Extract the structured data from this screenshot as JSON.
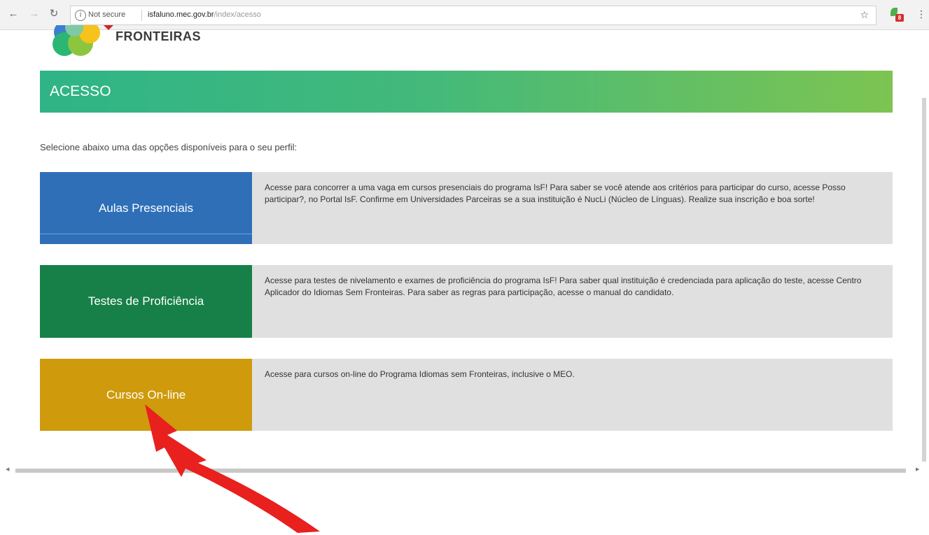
{
  "browser": {
    "security_info_glyph": "i",
    "security_label": "Not secure",
    "url_host": "isfaluno.mec.gov.br",
    "url_path": "/index/acesso",
    "icons": [
      "back-icon",
      "forward-icon",
      "reload-icon",
      "info-icon",
      "star-icon",
      "extension-icon",
      "menu-icon"
    ],
    "extension_badge": "8"
  },
  "brand": {
    "name": "FRONTEIRAS",
    "logo_colors": [
      "#3c7fd0",
      "#2bb673",
      "#8cc63f",
      "#f5c31b",
      "#7fc9a7"
    ]
  },
  "banner": {
    "title": "ACESSO"
  },
  "intro": "Selecione abaixo uma das opções disponíveis para o seu perfil:",
  "options": [
    {
      "label": "Aulas Presenciais",
      "color": "#2f6fb8",
      "description": "Acesse para concorrer a uma vaga em cursos presenciais do programa IsF! Para saber se você atende aos critérios para participar do curso, acesse Posso participar?, no Portal IsF. Confirme em Universidades Parceiras se a sua instituição é NucLi (Núcleo de Línguas). Realize sua inscrição e boa sorte!"
    },
    {
      "label": "Testes de Proficiência",
      "color": "#178048",
      "description": "Acesse para testes de nivelamento e exames de proficiência do programa IsF! Para saber qual instituição é credenciada para aplicação do teste, acesse Centro Aplicador do Idiomas Sem Fronteiras. Para saber as regras para participação, acesse o manual do candidato."
    },
    {
      "label": "Cursos On-line",
      "color": "#cf9a0c",
      "description": "Acesse para cursos on-line do Programa Idiomas sem Fronteiras, inclusive o MEO."
    }
  ],
  "annotation": {
    "arrow_color": "#e8201e"
  }
}
